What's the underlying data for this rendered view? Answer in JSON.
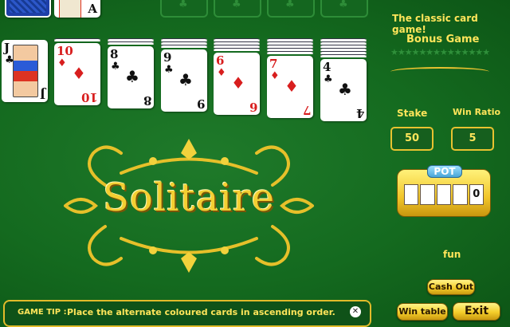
{
  "game": {
    "logo_text": "Solitaire",
    "tagline": "The classic card game!",
    "bonus_label": "Bonus Game"
  },
  "stock": {
    "face_up_card": "A"
  },
  "tableau": [
    {
      "rank": "J",
      "suit": "♣",
      "color": "black",
      "hidden": 0
    },
    {
      "rank": "10",
      "suit": "♦",
      "color": "red",
      "hidden": 1
    },
    {
      "rank": "8",
      "suit": "♣",
      "color": "black",
      "hidden": 2
    },
    {
      "rank": "9",
      "suit": "♣",
      "color": "black",
      "hidden": 3
    },
    {
      "rank": "6",
      "suit": "♦",
      "color": "red",
      "hidden": 4
    },
    {
      "rank": "7",
      "suit": "♦",
      "color": "red",
      "hidden": 5
    },
    {
      "rank": "4",
      "suit": "♣",
      "color": "black",
      "hidden": 6
    }
  ],
  "foundations": [
    {
      "suit": "♣"
    },
    {
      "suit": "♣"
    },
    {
      "suit": "♣"
    },
    {
      "suit": "♣"
    }
  ],
  "betting": {
    "stake_label": "Stake",
    "stake_value": "50",
    "win_ratio_label": "Win Ratio",
    "win_ratio_value": "5",
    "pot_label": "POT",
    "pot_value": "0",
    "mode_text": "fun"
  },
  "buttons": {
    "cash_out": "Cash Out",
    "win_table": "Win table",
    "exit": "Exit"
  },
  "tip": {
    "label": "GAME TIP :",
    "text": "Place the alternate coloured cards in ascending order.",
    "close": "✕"
  },
  "colors": {
    "felt": "#146a1f",
    "gold": "#f4cd2a",
    "card_red": "#d81e1e"
  }
}
